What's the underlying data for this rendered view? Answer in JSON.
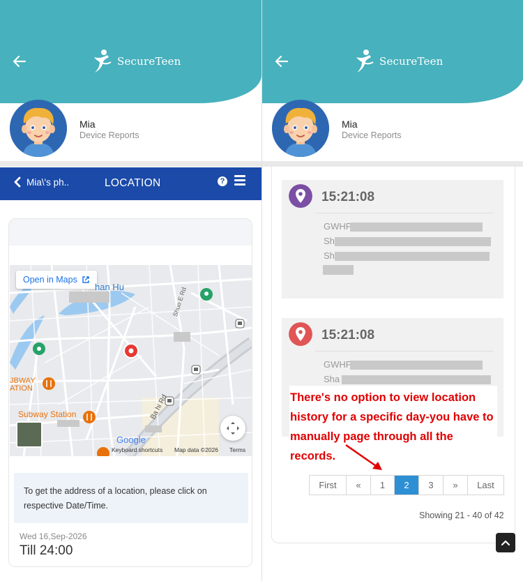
{
  "left": {
    "header": {
      "app_name": "SecureTeen",
      "back_icon": "back-arrow-icon"
    },
    "profile": {
      "name": "Mia",
      "subtitle": "Device Reports"
    },
    "navbar": {
      "back_label": "Mia\\'s ph..",
      "title": "LOCATION",
      "help_icon": "question-circle-icon",
      "menu_icon": "hamburger-menu-icon"
    },
    "map": {
      "open_in_maps": "Open in Maps",
      "labels": {
        "lake": "han Hu",
        "street1": "Shuo E Rd",
        "street2": "Ba  hi Rd",
        "subway_left": "JBWAY",
        "subway_left2": "ATION",
        "subway_station": "Subway Station",
        "google": "Google"
      },
      "footer": {
        "shortcuts": "Keyboard shortcuts",
        "map_data": "Map data ©2026",
        "terms": "Terms"
      }
    },
    "info_text": "To get the address of a location, please click on respective Date/Time.",
    "date": "Wed 16,Sep-2026",
    "till": "Till 24:00"
  },
  "right": {
    "header": {
      "app_name": "SecureTeen",
      "back_icon": "back-arrow-icon"
    },
    "profile": {
      "name": "Mia",
      "subtitle": "Device Reports"
    },
    "records": [
      {
        "time": "15:21:08",
        "pin_color": "#7b4fa3",
        "addr_lines": [
          "GWHP",
          "Sh",
          "Sh"
        ]
      },
      {
        "time": "15:21:08",
        "pin_color": "#e05555",
        "addr_lines": [
          "GWHP",
          "Sha",
          ""
        ]
      }
    ],
    "annotation": "There's no option to view location history for a specific day-you have to manually page through all the records.",
    "pagination": {
      "first": "First",
      "prev": "«",
      "pages": [
        "1",
        "2",
        "3"
      ],
      "active": "2",
      "next": "»",
      "last": "Last"
    },
    "showing": "Showing 21 - 40 of 42"
  }
}
